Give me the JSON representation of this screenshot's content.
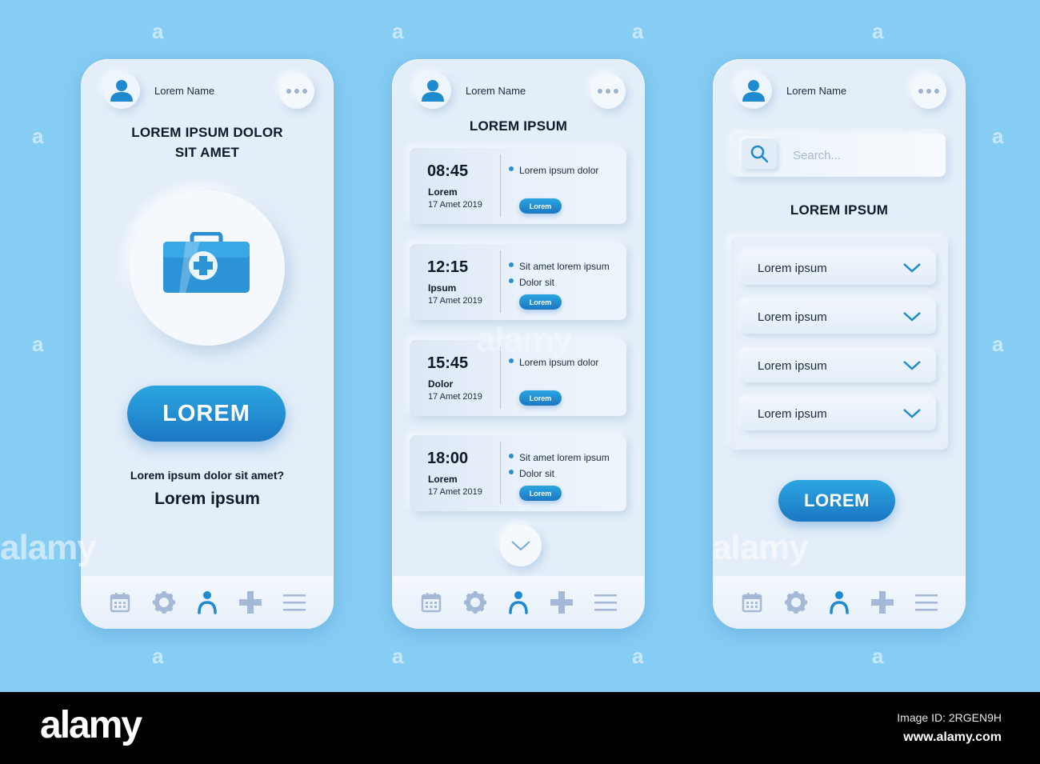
{
  "colors": {
    "background": "#86cdf4",
    "phone": "#e4eef9",
    "accent": "#1f8ad0",
    "text": "#10192a",
    "nav_icon": "#a5b8d6",
    "nav_active": "#1f8ad0"
  },
  "phones": [
    {
      "header": {
        "user_name": "Lorem Name",
        "avatar_icon": "user-avatar-icon",
        "more_icon": "more-dots-icon"
      },
      "title_line1": "LOREM IPSUM DOLOR",
      "title_line2": "SIT AMET",
      "illustration": "first-aid-kit-icon",
      "primary_button": "LOREM",
      "question": "Lorem ipsum dolor sit amet?",
      "link_text": "Lorem ipsum"
    },
    {
      "header": {
        "user_name": "Lorem Name"
      },
      "title": "LOREM IPSUM",
      "appointments": [
        {
          "time": "08:45",
          "label": "Lorem",
          "date": "17 Amet 2019",
          "items": [
            "Lorem ipsum dolor"
          ],
          "button": "Lorem"
        },
        {
          "time": "12:15",
          "label": "Ipsum",
          "date": "17 Amet 2019",
          "items": [
            "Sit amet lorem ipsum",
            "Dolor sit"
          ],
          "button": "Lorem"
        },
        {
          "time": "15:45",
          "label": "Dolor",
          "date": "17 Amet 2019",
          "items": [
            "Lorem ipsum dolor"
          ],
          "button": "Lorem"
        },
        {
          "time": "18:00",
          "label": "Lorem",
          "date": "17 Amet 2019",
          "items": [
            "Sit amet lorem ipsum",
            "Dolor sit"
          ],
          "button": "Lorem"
        }
      ],
      "scroll_down_icon": "chevron-down-icon"
    },
    {
      "header": {
        "user_name": "Lorem Name"
      },
      "search": {
        "placeholder": "Search...",
        "value": ""
      },
      "title": "LOREM IPSUM",
      "dropdowns": [
        "Lorem ipsum",
        "Lorem ipsum",
        "Lorem ipsum",
        "Lorem ipsum"
      ],
      "primary_button": "LOREM"
    }
  ],
  "bottom_nav": [
    {
      "name": "calendar",
      "icon": "calendar-icon",
      "active": false
    },
    {
      "name": "settings",
      "icon": "gear-icon",
      "active": false
    },
    {
      "name": "profile",
      "icon": "user-icon",
      "active": true
    },
    {
      "name": "add",
      "icon": "plus-icon",
      "active": false
    },
    {
      "name": "menu",
      "icon": "menu-icon",
      "active": false
    }
  ],
  "watermark": {
    "small": "a",
    "big": "alamy"
  },
  "footer": {
    "logo": "alamy",
    "image_id": "Image ID: 2RGEN9H",
    "url": "www.alamy.com"
  }
}
